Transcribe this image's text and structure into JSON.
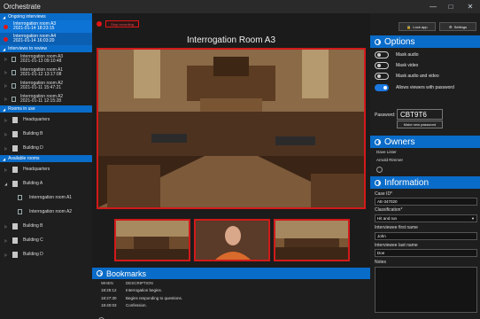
{
  "window": {
    "title": "Orchestrate",
    "min": "—",
    "max": "□",
    "close": "✕"
  },
  "sidebar": {
    "ongoing_header": "Ongoing interviews",
    "ongoing": [
      {
        "room": "Interrogation room A3",
        "time": "2021-01-14 18:23:15"
      },
      {
        "room": "Interrogation room A4",
        "time": "2021-01-14 16:03:20"
      }
    ],
    "review_header": "Interviews to review",
    "review": [
      {
        "room": "Interrogation room A3",
        "time": "2021-01-13 09:10:48"
      },
      {
        "room": "Interrogation room A1",
        "time": "2021-01-12 13:17:08"
      },
      {
        "room": "Interrogation room A2",
        "time": "2021-01-11 15:47:21"
      },
      {
        "room": "Interrogation room A2",
        "time": "2021-01-11 12:15:28"
      }
    ],
    "inuse_header": "Rooms in use",
    "inuse": [
      "Headquarters",
      "Building B",
      "Building D"
    ],
    "available_header": "Available rooms",
    "available": {
      "headquarters": "Headquarters",
      "building_a": "Building A",
      "rooms_a": [
        "Interrogation room A1",
        "Interrogation room A2"
      ],
      "others": [
        "Building B",
        "Building C",
        "Building D"
      ]
    }
  },
  "center": {
    "stop_label": "Stop recording",
    "room_title": "Interrogation Room A3",
    "bookmarks_title": "Bookmarks",
    "bm_headers": {
      "when": "WHEN",
      "description": "DESCRIPTION"
    },
    "bookmarks": [
      {
        "when": "18:25:12",
        "desc": "Interrogation begins."
      },
      {
        "when": "18:27:30",
        "desc": "Begins responding to questions."
      },
      {
        "when": "18:40:03",
        "desc": "Confession."
      }
    ]
  },
  "right": {
    "lock_label": "Lock app",
    "settings_label": "Settings",
    "options_title": "Options",
    "options": [
      {
        "label": "Mask audio",
        "on": false
      },
      {
        "label": "Mask video",
        "on": false
      },
      {
        "label": "Mask audio and video",
        "on": false
      },
      {
        "label": "Allows viewers with password",
        "on": true
      }
    ],
    "password_label": "Password:",
    "password_value": "CBT9T6",
    "make_pw_label": "Make new password",
    "owners_title": "Owners",
    "owners": [
      "Dave Lister",
      "Arnold Rimmer"
    ],
    "info_title": "Information",
    "case_id_label": "Case ID*",
    "case_id_value": "AE-347020",
    "class_label": "Classification*",
    "class_value": "Hit and run",
    "first_label": "Interviewee first name",
    "first_value": "John",
    "last_label": "Interviewee last name",
    "last_value": "Doe",
    "notes_label": "Notes"
  },
  "colors": {
    "accent": "#0a6cc9",
    "record_red": "#e01616",
    "frame_red": "#d11a1a"
  }
}
